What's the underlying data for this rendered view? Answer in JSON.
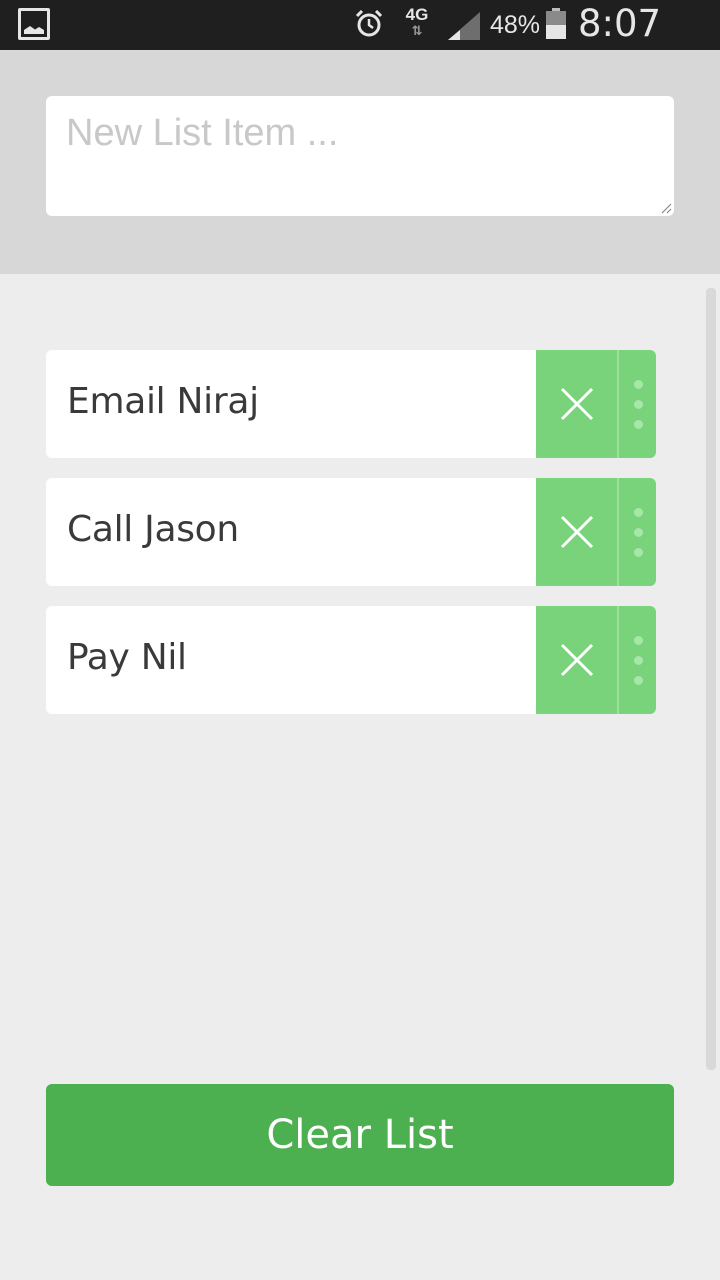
{
  "status_bar": {
    "network": "4G",
    "battery_percent": "48%",
    "time": "8:07 PM",
    "icons": [
      "gallery-icon",
      "alarm-icon",
      "data-arrows-icon",
      "signal-icon",
      "battery-icon"
    ]
  },
  "new_item": {
    "placeholder": "New List Item ...",
    "value": ""
  },
  "list": {
    "items": [
      {
        "label": "Email Niraj"
      },
      {
        "label": "Call Jason"
      },
      {
        "label": "Pay Nil"
      }
    ]
  },
  "actions": {
    "clear_label": "Clear List"
  },
  "colors": {
    "accent": "#4caf50",
    "item_action": "#78d37a",
    "header_bg": "#d7d7d7",
    "page_bg": "#ededed"
  }
}
